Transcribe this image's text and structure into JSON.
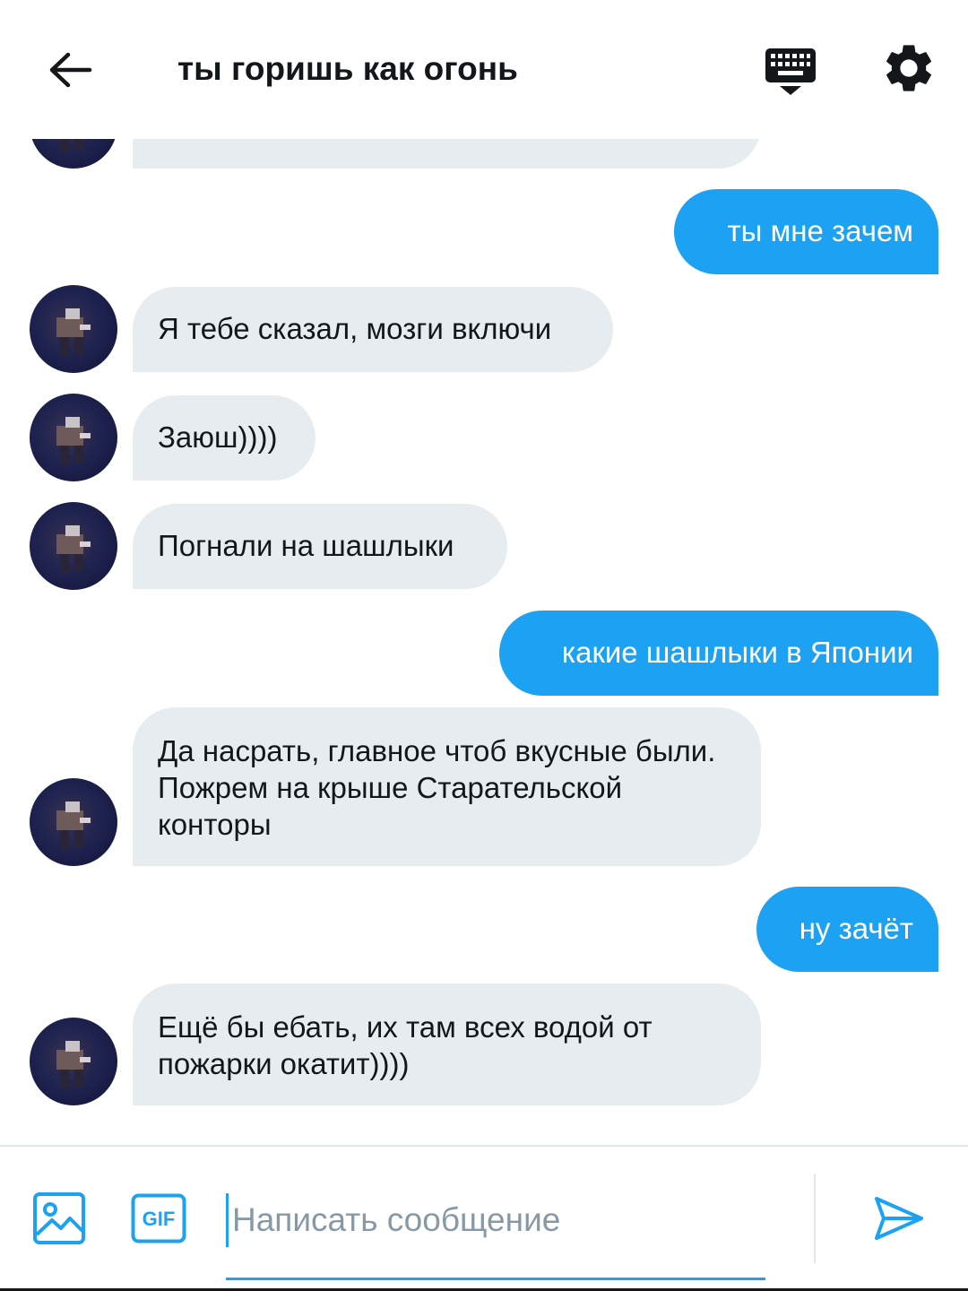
{
  "header": {
    "title": "ты горишь как огонь",
    "back_icon": "arrow-left-icon",
    "keyboard_icon": "keyboard-icon",
    "settings_icon": "gear-icon"
  },
  "colors": {
    "accent": "#1da1f2",
    "incoming_bubble": "#e6ecf0",
    "text": "#14171a",
    "placeholder": "#8899a6"
  },
  "messages": [
    {
      "direction": "incoming",
      "text": "",
      "partial": true
    },
    {
      "direction": "outgoing",
      "text": "ты мне зачем"
    },
    {
      "direction": "incoming",
      "text": "Я тебе сказал, мозги включи"
    },
    {
      "direction": "incoming",
      "text": "Заюш))))"
    },
    {
      "direction": "incoming",
      "text": "Погнали на шашлыки"
    },
    {
      "direction": "outgoing",
      "text": "какие шашлыки в Японии"
    },
    {
      "direction": "incoming",
      "text": "Да насрать, главное чтоб вкусные были. Пожрем на крыше Старательской конторы"
    },
    {
      "direction": "outgoing",
      "text": "ну зачёт"
    },
    {
      "direction": "incoming",
      "text": "Ещё бы ебать, их там всех водой от пожарки окатит))))"
    }
  ],
  "composer": {
    "placeholder": "Написать сообщение",
    "value": "",
    "gif_label": "GIF",
    "media_icon": "image-icon",
    "send_icon": "send-icon"
  }
}
